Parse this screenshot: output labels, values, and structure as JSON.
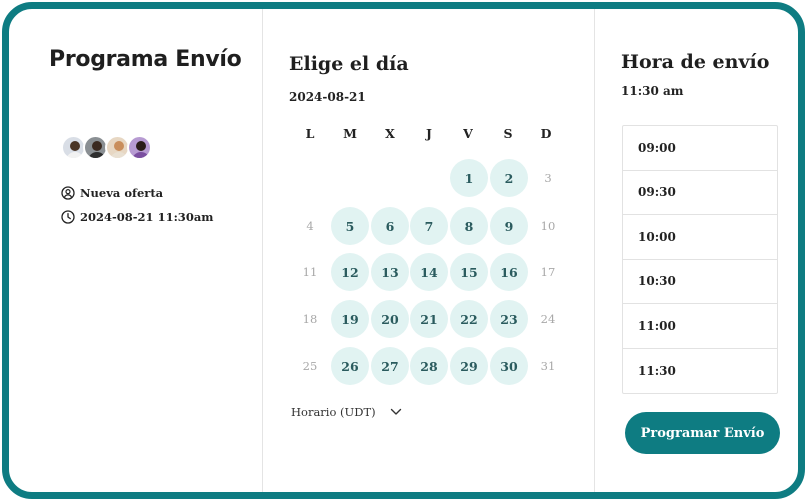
{
  "left": {
    "title": "Programa Envío",
    "offer": "Nueva oferta",
    "datetime": "2024-08-21 11:30am"
  },
  "calendar": {
    "title": "Elige el día",
    "date": "2024-08-21",
    "weekdays": [
      "L",
      "M",
      "X",
      "J",
      "V",
      "S",
      "D"
    ],
    "days": [
      "1",
      "2",
      "3",
      "4",
      "5",
      "6",
      "7",
      "8",
      "9",
      "10",
      "11",
      "12",
      "13",
      "14",
      "15",
      "16",
      "17",
      "18",
      "19",
      "20",
      "21",
      "22",
      "23",
      "24",
      "25",
      "26",
      "27",
      "28",
      "29",
      "30",
      "31"
    ],
    "timezone": "Horario (UDT)"
  },
  "time": {
    "title": "Hora de envío",
    "selected": "11:30 am",
    "slots": [
      "09:00",
      "09:30",
      "10:00",
      "10:30",
      "11:00",
      "11:30"
    ]
  },
  "button": {
    "label": "Programar Envío"
  },
  "colors": {
    "accent": "#0e7c82",
    "day_bg": "#e1f3f2",
    "day_text": "#2a5b5e",
    "muted": "#a8a8a8"
  }
}
